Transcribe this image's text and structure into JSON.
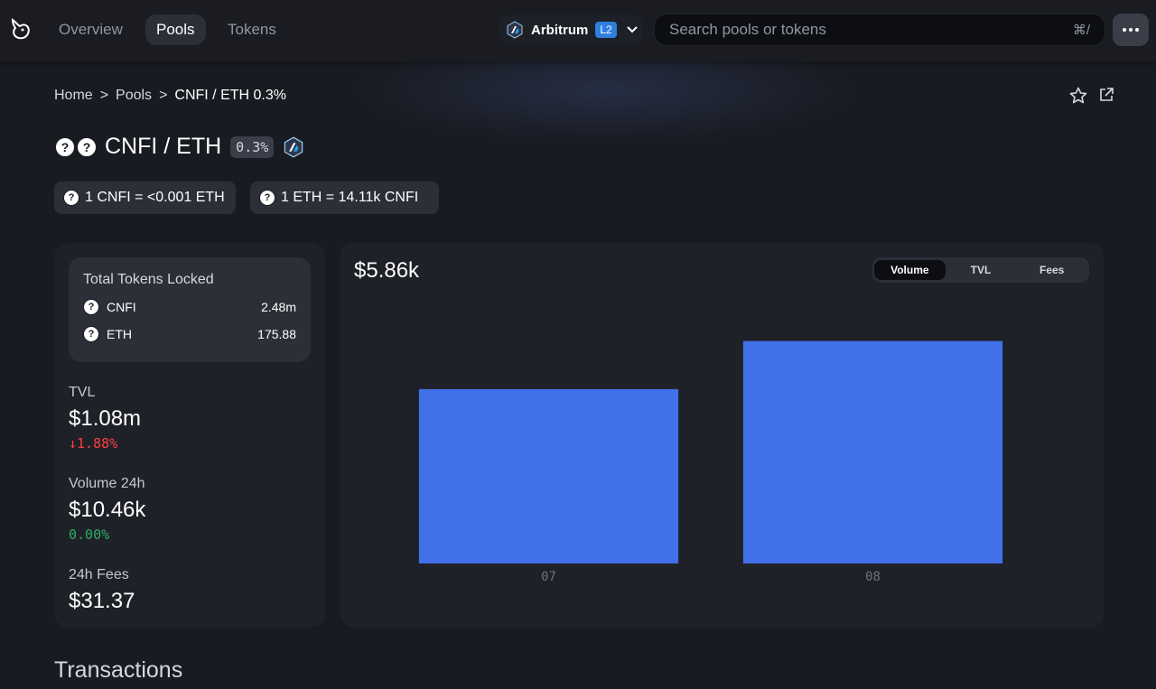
{
  "nav": {
    "links": [
      {
        "label": "Overview",
        "active": false
      },
      {
        "label": "Pools",
        "active": true
      },
      {
        "label": "Tokens",
        "active": false
      }
    ],
    "network": {
      "label": "Arbitrum",
      "badge": "L2"
    },
    "search": {
      "placeholder": "Search pools or tokens",
      "shortcut": "⌘/"
    },
    "more_icon": "ellipsis-icon"
  },
  "breadcrumb": {
    "home": "Home",
    "sep1": ">",
    "pools": "Pools",
    "sep2": ">",
    "current": "CNFI / ETH 0.3%"
  },
  "pool": {
    "title": "CNFI / ETH",
    "fee": "0.3%",
    "price_chips": [
      "1 CNFI = <0.001 ETH",
      "1 ETH = 14.11k CNFI"
    ]
  },
  "locked": {
    "title": "Total Tokens Locked",
    "tokens": [
      {
        "symbol": "CNFI",
        "amount": "2.48m"
      },
      {
        "symbol": "ETH",
        "amount": "175.88"
      }
    ]
  },
  "stats": {
    "tvl": {
      "label": "TVL",
      "value": "$1.08m",
      "change": "1.88%",
      "direction": "down"
    },
    "volume": {
      "label": "Volume 24h",
      "value": "$10.46k",
      "change": "0.00%"
    },
    "fees": {
      "label": "24h Fees",
      "value": "$31.37"
    }
  },
  "chart_header": {
    "value": "$5.86k",
    "tabs": [
      {
        "label": "Volume",
        "active": true
      },
      {
        "label": "TVL",
        "active": false
      },
      {
        "label": "Fees",
        "active": false
      }
    ]
  },
  "chart_data": {
    "type": "bar",
    "categories": [
      "07",
      "08"
    ],
    "values": [
      4.2,
      5.36
    ],
    "ylim": [
      0,
      6.2
    ],
    "bar_color": "#4170e8"
  },
  "sections": {
    "transactions": "Transactions"
  },
  "colors": {
    "accent": "#4170e8",
    "negative": "#fd4040",
    "positive": "#27ae60"
  }
}
